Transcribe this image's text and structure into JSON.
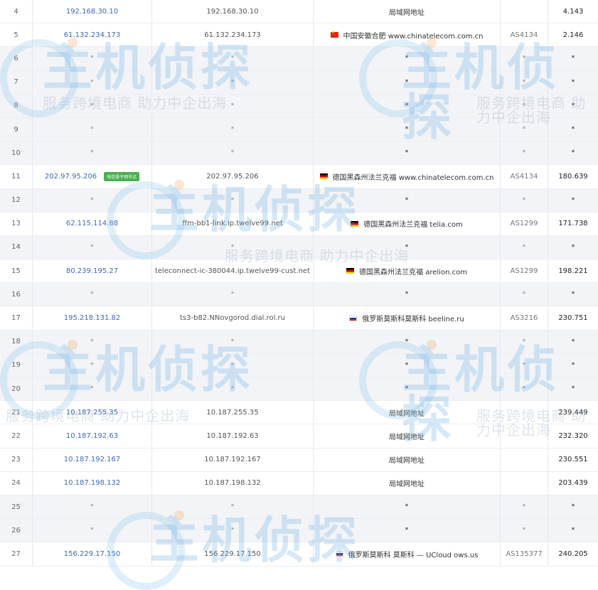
{
  "rows": [
    {
      "hop": "4",
      "ip": "192.168.30.10",
      "host": "192.168.30.10",
      "flag": "",
      "location": "局域网地址",
      "asn": "",
      "rtt": "4.143"
    },
    {
      "hop": "5",
      "ip": "61.132.234.173",
      "host": "61.132.234.173",
      "flag": "cn",
      "location": "中国安徽合肥 www.chinatelecom.com.cn",
      "asn": "AS4134",
      "rtt": "2.146"
    },
    {
      "hop": "6",
      "ip": "*",
      "host": "*",
      "flag": "",
      "location": "*",
      "asn": "*",
      "rtt": "*"
    },
    {
      "hop": "7",
      "ip": "*",
      "host": "*",
      "flag": "",
      "location": "*",
      "asn": "*",
      "rtt": "*"
    },
    {
      "hop": "8",
      "ip": "*",
      "host": "*",
      "flag": "",
      "location": "*",
      "asn": "*",
      "rtt": "*"
    },
    {
      "hop": "9",
      "ip": "*",
      "host": "*",
      "flag": "",
      "location": "*",
      "asn": "*",
      "rtt": "*"
    },
    {
      "hop": "10",
      "ip": "*",
      "host": "*",
      "flag": "",
      "location": "*",
      "asn": "*",
      "rtt": "*"
    },
    {
      "hop": "11",
      "ip": "202.97.95.206",
      "badge": "电信骨干网节点",
      "host": "202.97.95.206",
      "flag": "de",
      "location": "德国黑森州法兰克福 www.chinatelecom.com.cn",
      "asn": "AS4134",
      "rtt": "180.639"
    },
    {
      "hop": "12",
      "ip": "*",
      "host": "*",
      "flag": "",
      "location": "*",
      "asn": "*",
      "rtt": "*"
    },
    {
      "hop": "13",
      "ip": "62.115.114.88",
      "host": "ffm-bb1-link.ip.twelve99.net",
      "flag": "de",
      "location": "德国黑森州法兰克福 telia.com",
      "asn": "AS1299",
      "rtt": "171.738"
    },
    {
      "hop": "14",
      "ip": "*",
      "host": "*",
      "flag": "",
      "location": "*",
      "asn": "*",
      "rtt": "*"
    },
    {
      "hop": "15",
      "ip": "80.239.195.27",
      "host": "teleconnect-ic-380044.ip.twelve99-cust.net",
      "flag": "de",
      "location": "德国黑森州法兰克福 arelion.com",
      "asn": "AS1299",
      "rtt": "198.221"
    },
    {
      "hop": "16",
      "ip": "*",
      "host": "*",
      "flag": "",
      "location": "*",
      "asn": "*",
      "rtt": "*"
    },
    {
      "hop": "17",
      "ip": "195.218.131.82",
      "host": "ts3-b82.NNovgorod.dial.rol.ru",
      "flag": "ru",
      "location": "俄罗斯莫斯科莫斯科 beeline.ru",
      "asn": "AS3216",
      "rtt": "230.751"
    },
    {
      "hop": "18",
      "ip": "*",
      "host": "*",
      "flag": "",
      "location": "*",
      "asn": "*",
      "rtt": "*"
    },
    {
      "hop": "19",
      "ip": "*",
      "host": "*",
      "flag": "",
      "location": "*",
      "asn": "*",
      "rtt": "*"
    },
    {
      "hop": "20",
      "ip": "*",
      "host": "*",
      "flag": "",
      "location": "*",
      "asn": "*",
      "rtt": "*"
    },
    {
      "hop": "21",
      "ip": "10.187.255.35",
      "host": "10.187.255.35",
      "flag": "",
      "location": "局域网地址",
      "asn": "",
      "rtt": "239.449"
    },
    {
      "hop": "22",
      "ip": "10.187.192.63",
      "host": "10.187.192.63",
      "flag": "",
      "location": "局域网地址",
      "asn": "",
      "rtt": "232.320"
    },
    {
      "hop": "23",
      "ip": "10.187.192.167",
      "host": "10.187.192.167",
      "flag": "",
      "location": "局域网地址",
      "asn": "",
      "rtt": "230.551"
    },
    {
      "hop": "24",
      "ip": "10.187.198.132",
      "host": "10.187.198.132",
      "flag": "",
      "location": "局域网地址",
      "asn": "",
      "rtt": "203.439"
    },
    {
      "hop": "25",
      "ip": "*",
      "host": "*",
      "flag": "",
      "location": "*",
      "asn": "*",
      "rtt": "*"
    },
    {
      "hop": "26",
      "ip": "*",
      "host": "*",
      "flag": "",
      "location": "*",
      "asn": "*",
      "rtt": "*"
    },
    {
      "hop": "27",
      "ip": "156.229.17.150",
      "host": "156.229.17.150",
      "flag": "ru",
      "location": "俄罗斯莫斯科 莫斯科 — UCloud ows.us",
      "asn": "AS135377",
      "rtt": "240.205"
    }
  ],
  "watermark": {
    "logo_text": "主机侦探",
    "slogan": "服务跨境电商 助力中企出海"
  },
  "colors": {
    "ip_link": "#3f68b3",
    "badge": "#4caf50",
    "alt_row": "#f3f4f7",
    "watermark_logo": "#6aaee6"
  }
}
